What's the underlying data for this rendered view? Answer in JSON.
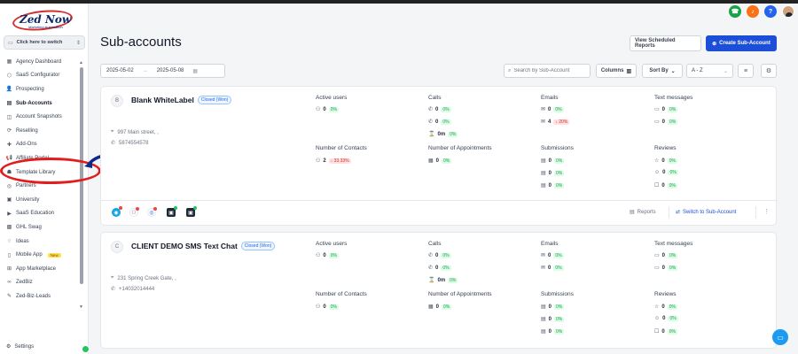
{
  "logo": {
    "text": "Zed Now",
    "tagline": "Marketing Automation"
  },
  "switcher": {
    "label": "Click here to switch"
  },
  "sidebar": {
    "items": [
      {
        "label": "Agency Dashboard",
        "icon": "dashboard-icon",
        "glyph": "▦"
      },
      {
        "label": "SaaS Configurator",
        "icon": "cube-icon",
        "glyph": "⬡"
      },
      {
        "label": "Prospecting",
        "icon": "user-search-icon",
        "glyph": "👤"
      },
      {
        "label": "Sub-Accounts",
        "icon": "building-icon",
        "glyph": "▤",
        "active": true
      },
      {
        "label": "Account Snapshots",
        "icon": "camera-icon",
        "glyph": "◫"
      },
      {
        "label": "Reselling",
        "icon": "refresh-icon",
        "glyph": "⟳"
      },
      {
        "label": "Add-Ons",
        "icon": "puzzle-icon",
        "glyph": "✚"
      },
      {
        "label": "Affiliate Portal",
        "icon": "megaphone-icon",
        "glyph": "📢"
      },
      {
        "label": "Template Library",
        "icon": "library-icon",
        "glyph": "☗"
      },
      {
        "label": "Partners",
        "icon": "handshake-icon",
        "glyph": "◎"
      },
      {
        "label": "University",
        "icon": "graduation-icon",
        "glyph": "▣"
      },
      {
        "label": "SaaS Education",
        "icon": "video-icon",
        "glyph": "▶"
      },
      {
        "label": "GHL Swag",
        "icon": "shirt-icon",
        "glyph": "▩"
      },
      {
        "label": "Ideas",
        "icon": "lightbulb-icon",
        "glyph": "♢"
      },
      {
        "label": "Mobile App",
        "icon": "phone-icon",
        "glyph": "▯",
        "badge": "New"
      },
      {
        "label": "App Marketplace",
        "icon": "grid-icon",
        "glyph": "⊞"
      },
      {
        "label": "ZedBiz",
        "icon": "link-icon",
        "glyph": "∞"
      },
      {
        "label": "Zed-Biz-Leads",
        "icon": "wrench-icon",
        "glyph": "✎"
      }
    ],
    "settings_label": "Settings"
  },
  "header": {
    "title": "Sub-accounts",
    "view_reports": "View Scheduled Reports",
    "create": "Create Sub-Account"
  },
  "filters": {
    "date_from": "2025-05-02",
    "date_to": "2025-05-08",
    "search_placeholder": "Search by Sub-Account",
    "columns": "Columns",
    "sort_by": "Sort By",
    "sort_value": "A - Z"
  },
  "annotation": {
    "number": "2"
  },
  "accounts": [
    {
      "initial": "B",
      "name": "Blank WhiteLabel",
      "status": "Closed (Won)",
      "address": "997 Main street, ,",
      "phone": "5874554578",
      "active_users_label": "Active users",
      "active_users": "0",
      "active_users_pct": "0%",
      "contacts_label": "Number of Contacts",
      "contacts": "2",
      "contacts_pct": "33.33%",
      "calls_label": "Calls",
      "calls_in": "0",
      "calls_in_pct": "0%",
      "calls_out": "0",
      "calls_out_pct": "0%",
      "calls_dur": "0m",
      "calls_dur_pct": "0%",
      "appointments_label": "Number of Appointments",
      "appointments": "0",
      "appointments_pct": "0%",
      "emails_label": "Emails",
      "emails_a": "0",
      "emails_a_pct": "0%",
      "emails_b": "4",
      "emails_b_pct": "20%",
      "submissions_label": "Submissions",
      "sub_a": "0",
      "sub_a_pct": "0%",
      "sub_b": "0",
      "sub_b_pct": "0%",
      "sub_c": "0",
      "sub_c_pct": "0%",
      "texts_label": "Text messages",
      "texts_a": "0",
      "texts_a_pct": "0%",
      "texts_b": "0",
      "texts_b_pct": "0%",
      "reviews_label": "Reviews",
      "rev_a": "0",
      "rev_a_pct": "0%",
      "rev_b": "0",
      "rev_b_pct": "0%",
      "rev_c": "0",
      "rev_c_pct": "0%",
      "reports": "Reports",
      "switch": "Switch to Sub-Account"
    },
    {
      "initial": "C",
      "name": "CLIENT DEMO SMS Text Chat",
      "status": "Closed (Won)",
      "address": "231 Spring Creek Gate, ,",
      "phone": "+14032014444",
      "active_users_label": "Active users",
      "active_users": "0",
      "active_users_pct": "0%",
      "contacts_label": "Number of Contacts",
      "contacts": "0",
      "contacts_pct": "0%",
      "calls_label": "Calls",
      "calls_in": "0",
      "calls_in_pct": "0%",
      "calls_out": "0",
      "calls_out_pct": "0%",
      "calls_dur": "0m",
      "calls_dur_pct": "0%",
      "appointments_label": "Number of Appointments",
      "appointments": "0",
      "appointments_pct": "0%",
      "emails_label": "Emails",
      "emails_a": "0",
      "emails_a_pct": "0%",
      "emails_b": "0",
      "emails_b_pct": "0%",
      "submissions_label": "Submissions",
      "sub_a": "0",
      "sub_a_pct": "0%",
      "sub_b": "0",
      "sub_b_pct": "0%",
      "sub_c": "0",
      "sub_c_pct": "0%",
      "texts_label": "Text messages",
      "texts_a": "0",
      "texts_a_pct": "0%",
      "texts_b": "0",
      "texts_b_pct": "0%",
      "reviews_label": "Reviews",
      "rev_a": "0",
      "rev_a_pct": "0%",
      "rev_b": "0",
      "rev_b_pct": "0%",
      "rev_c": "0",
      "rev_c_pct": "0%"
    }
  ],
  "colors": {
    "primary": "#1d4ed8",
    "annotation_red": "#e11d1d",
    "annotation_blue": "#0b2a8a"
  }
}
